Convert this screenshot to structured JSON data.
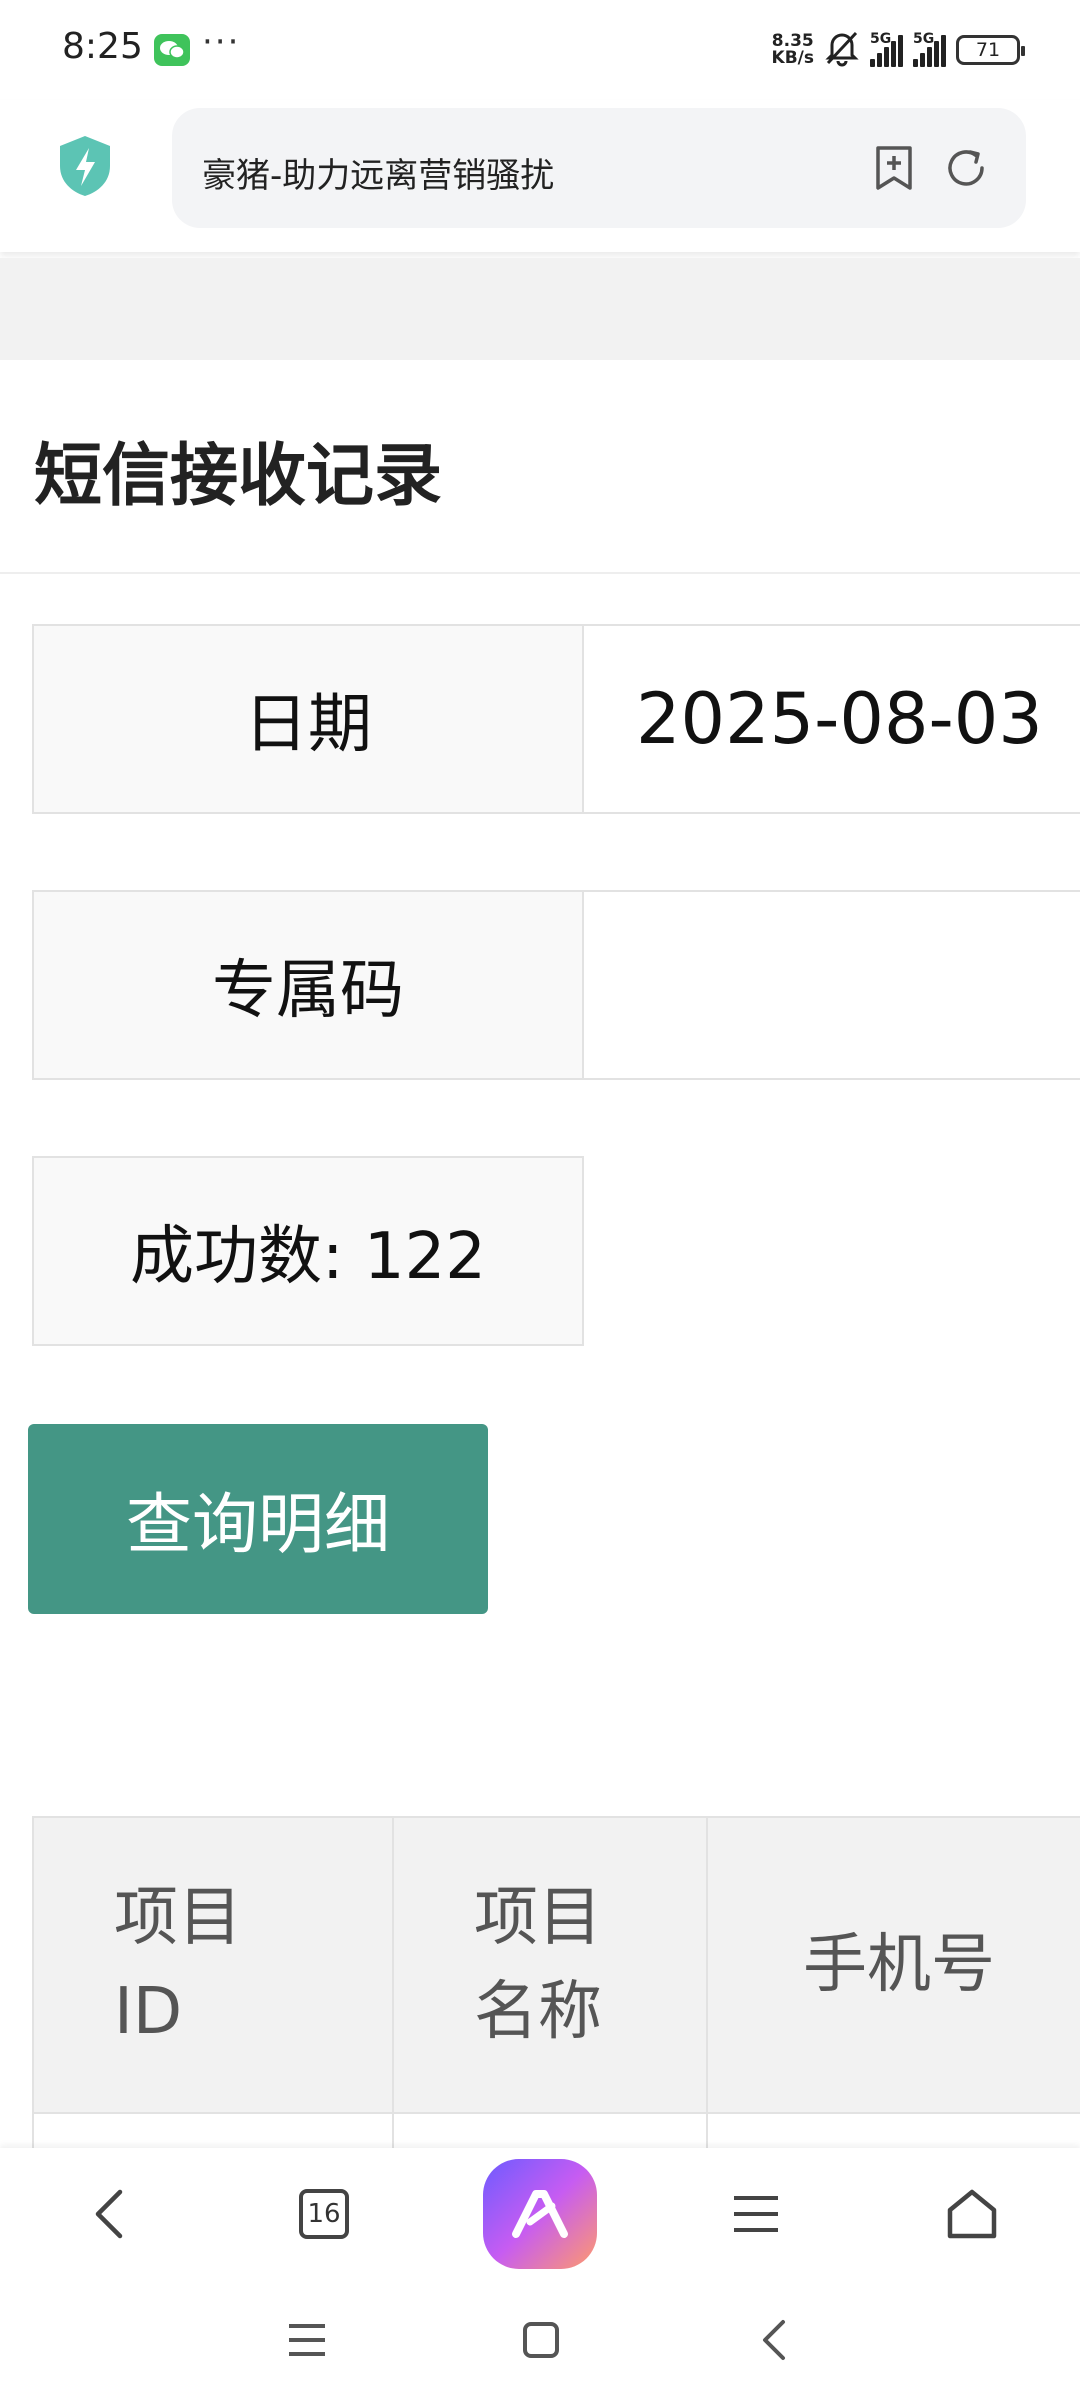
{
  "status_bar": {
    "time": "8:25",
    "more_dots": "···",
    "net_speed_value": "8.35",
    "net_speed_unit": "KB/s",
    "signal1_label": "5G",
    "signal2_label": "5G",
    "battery": "71"
  },
  "browser": {
    "url_title": "豪猪-助力远离营销骚扰"
  },
  "page": {
    "title": "短信接收记录",
    "date_label": "日期",
    "date_value": "2025-08-03",
    "code_label": "专属码",
    "code_value": "",
    "success_count": "成功数: 122",
    "query_button": "查询明细"
  },
  "table": {
    "headers": [
      "项目\nID",
      "项目\n名称",
      "手机号"
    ]
  },
  "bottom_nav": {
    "tab_count": "16"
  },
  "colors": {
    "accent": "#449685",
    "shield": "#5cc4b4"
  }
}
